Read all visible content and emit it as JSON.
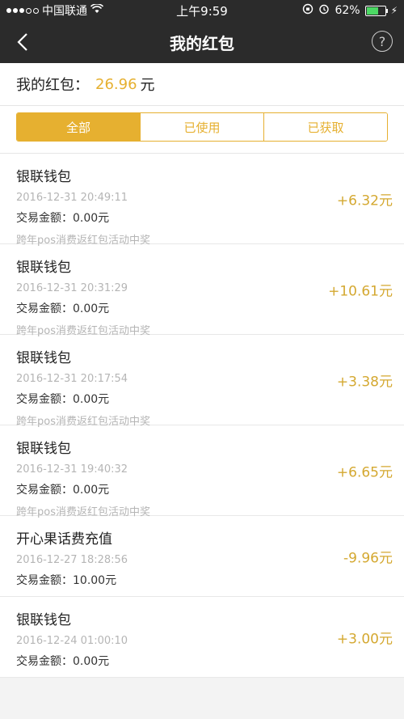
{
  "status": {
    "carrier": "中国联通",
    "time": "上午9:59",
    "battery": "62%"
  },
  "nav": {
    "title": "我的红包",
    "help": "?"
  },
  "summary": {
    "label": "我的红包：",
    "amount": "26.96",
    "unit": "元"
  },
  "tabs": [
    "全部",
    "已使用",
    "已获取"
  ],
  "items": [
    {
      "name": "银联钱包",
      "time": "2016-12-31 20:49:11",
      "trade": "交易金额：0.00元",
      "note": "跨年pos消费返红包活动中奖",
      "amount": "+6.32元"
    },
    {
      "name": "银联钱包",
      "time": "2016-12-31 20:31:29",
      "trade": "交易金额：0.00元",
      "note": "跨年pos消费返红包活动中奖",
      "amount": "+10.61元"
    },
    {
      "name": "银联钱包",
      "time": "2016-12-31 20:17:54",
      "trade": "交易金额：0.00元",
      "note": "跨年pos消费返红包活动中奖",
      "amount": "+3.38元"
    },
    {
      "name": "银联钱包",
      "time": "2016-12-31 19:40:32",
      "trade": "交易金额：0.00元",
      "note": "跨年pos消费返红包活动中奖",
      "amount": "+6.65元"
    },
    {
      "name": "开心果话费充值",
      "time": "2016-12-27 18:28:56",
      "trade": "交易金额：10.00元",
      "note": "",
      "amount": "-9.96元"
    },
    {
      "name": "银联钱包",
      "time": "2016-12-24 01:00:10",
      "trade": "交易金额：0.00元",
      "note": "",
      "amount": "+3.00元"
    }
  ]
}
